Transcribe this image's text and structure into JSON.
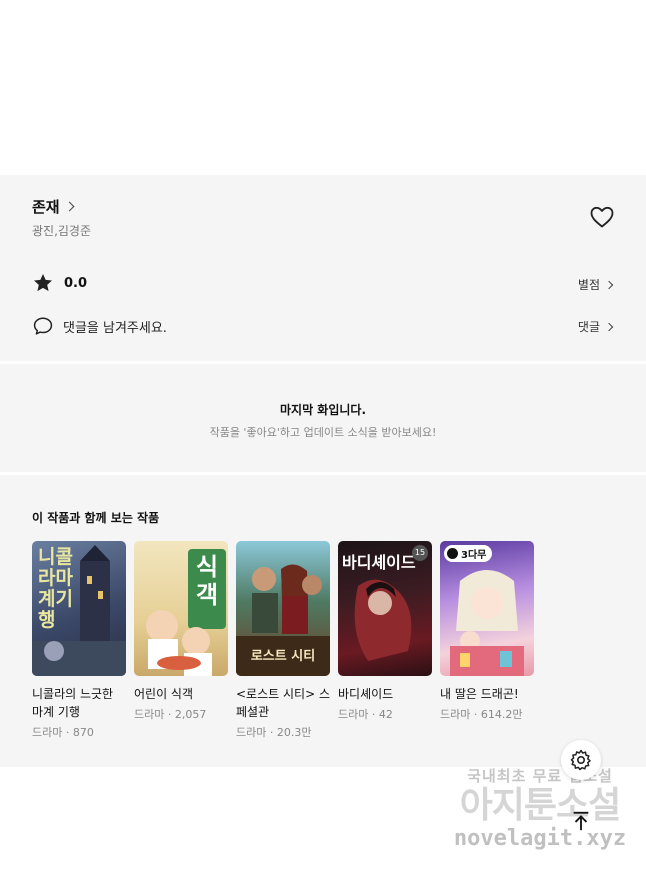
{
  "work": {
    "title": "존재",
    "authors": "광진,김경준"
  },
  "rating": {
    "value": "0.0",
    "link_label": "별점"
  },
  "comments": {
    "prompt": "댓글을 남겨주세요.",
    "link_label": "댓글"
  },
  "last_episode": {
    "title": "마지막 화입니다.",
    "subtitle": "작품을 '좋아요'하고 업데이트 소식을 받아보세요!"
  },
  "recommendations": {
    "heading": "이 작품과 함께 보는 작품",
    "items": [
      {
        "title": "니콜라의 느긋한 마계 기행",
        "meta": "드라마 · 870",
        "cover_text": "니콜라 마계 기행",
        "cover_colors": [
          "#4d5a78",
          "#2f3b57"
        ]
      },
      {
        "title": "어린이 식객",
        "meta": "드라마 · 2,057",
        "cover_text": "식객",
        "cover_colors": [
          "#e9d7a8",
          "#c94b3a"
        ]
      },
      {
        "title": "<로스트 시티> 스페셜관",
        "meta": "드라마 · 20.3만",
        "cover_text": "로스트 시티",
        "cover_colors": [
          "#7ab6c9",
          "#8a4a2a"
        ]
      },
      {
        "title": "바디셰이드",
        "meta": "드라마 · 42",
        "cover_text": "바디셰이드",
        "cover_badge": "15",
        "cover_colors": [
          "#2a1a1e",
          "#7a1f25"
        ]
      },
      {
        "title": "내 딸은 드래곤!",
        "meta": "드라마 · 614.2만",
        "cover_badge": "3다무",
        "cover_colors": [
          "#9a7ad6",
          "#f1c7d8"
        ]
      }
    ]
  },
  "icons": {
    "heart": "heart-outline-icon",
    "star": "star-filled-icon",
    "comment": "speech-bubble-icon",
    "settings": "gear-icon",
    "top": "arrow-to-top-icon"
  },
  "watermark": {
    "line1": "국내최초 무료 웹소설",
    "line2": "아지툰소설",
    "line3": "novelagit.xyz"
  }
}
